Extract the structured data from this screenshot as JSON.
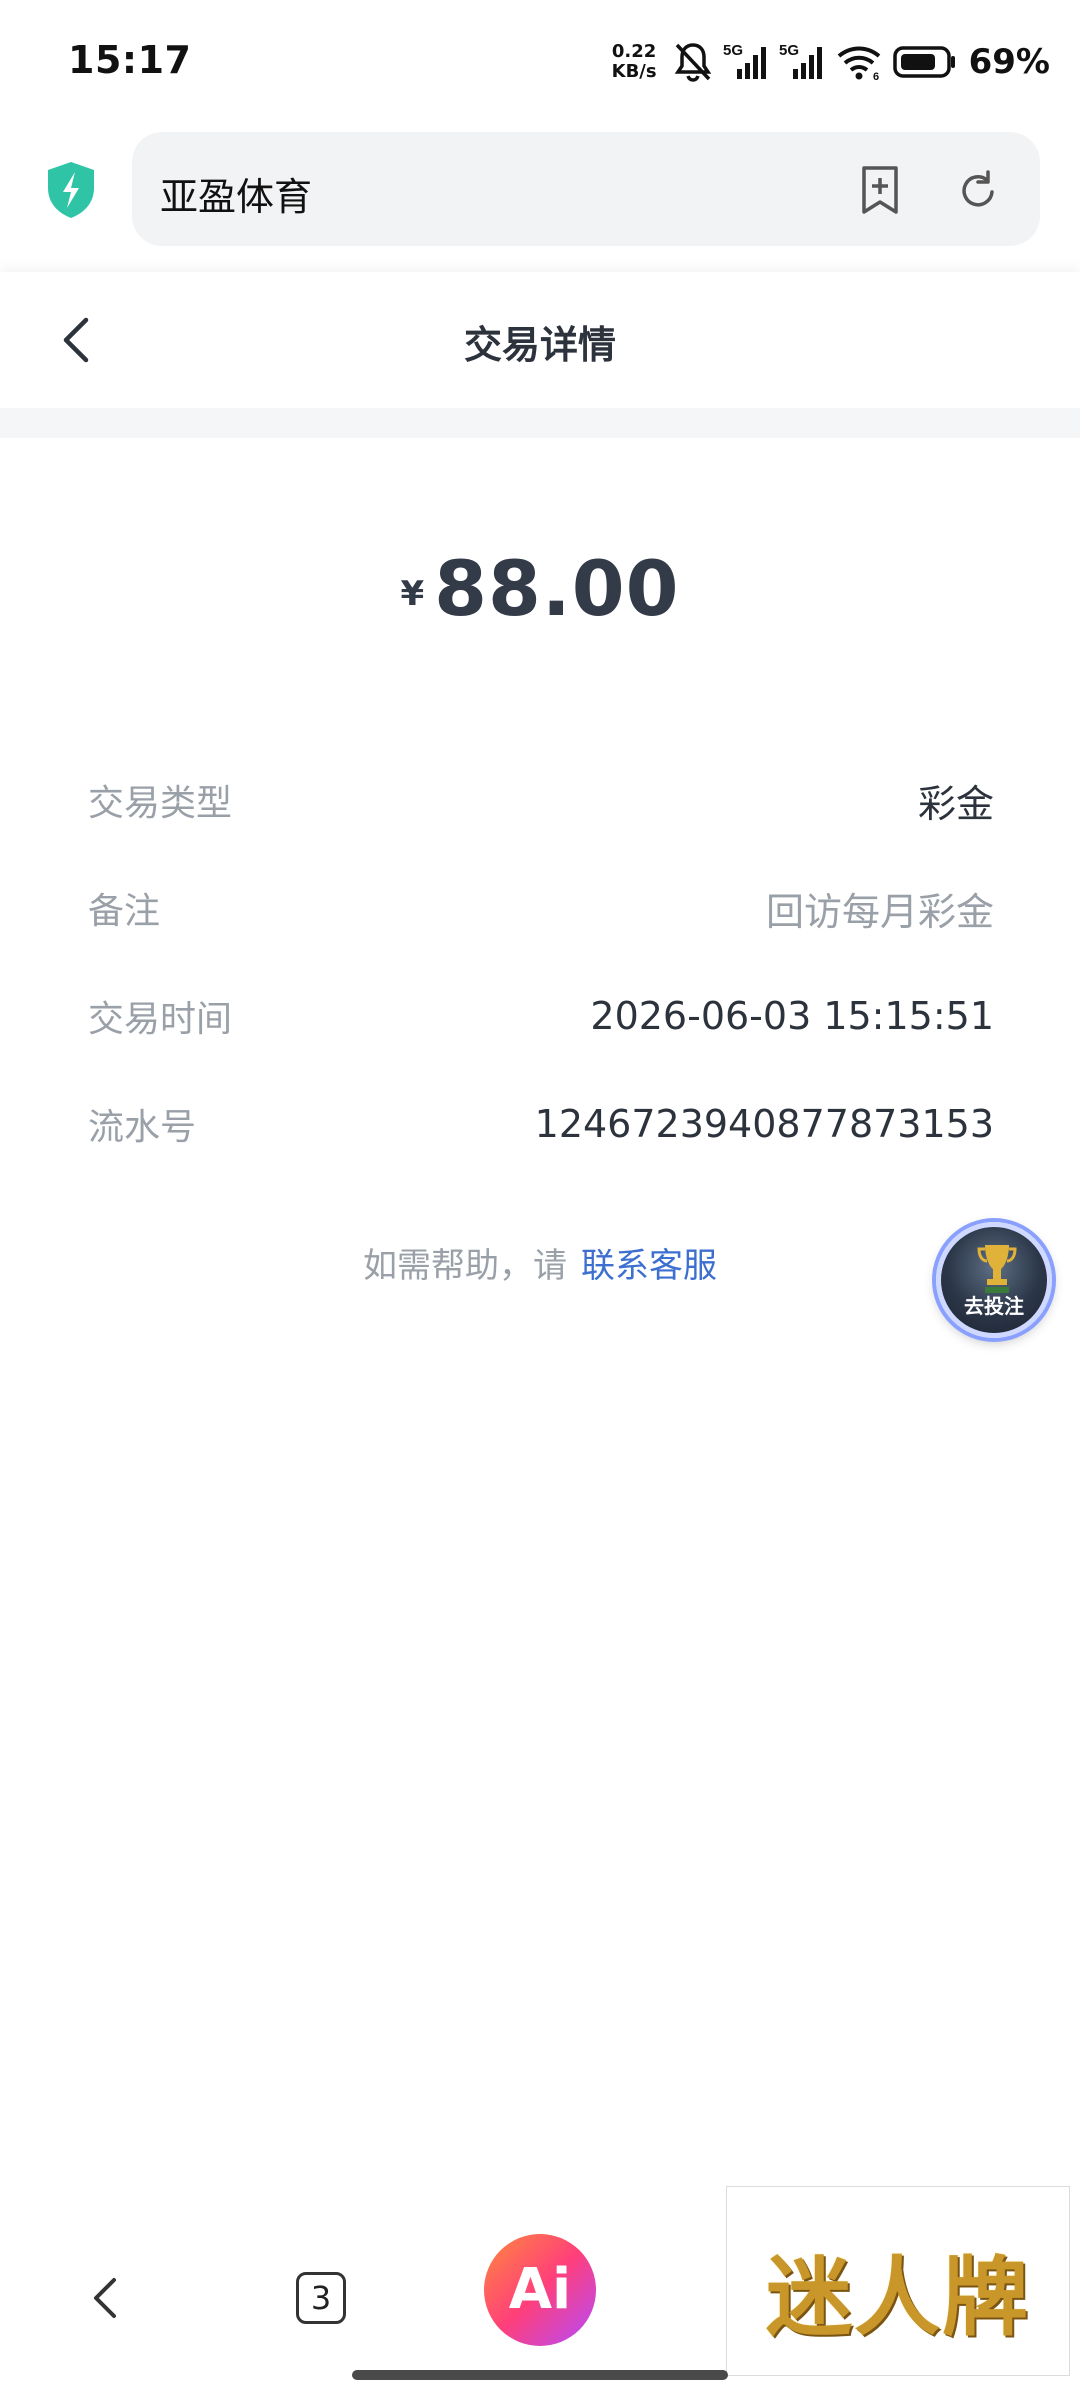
{
  "status_bar": {
    "time": "15:17",
    "net_speed_value": "0.22",
    "net_speed_unit": "KB/s",
    "battery_percent": "69%",
    "icons": [
      "mute-bell-icon",
      "signal-5g-icon",
      "signal-5g-icon",
      "wifi-icon",
      "battery-icon"
    ]
  },
  "browser": {
    "url_text": "亚盈体育",
    "icons": [
      "shield-icon",
      "bookmark-add-icon",
      "refresh-icon"
    ]
  },
  "header": {
    "title": "交易详情",
    "back_icon": "chevron-left-icon"
  },
  "transaction": {
    "currency_symbol": "¥",
    "amount": "88.00",
    "rows": [
      {
        "label": "交易类型",
        "value": "彩金"
      },
      {
        "label": "备注",
        "value": "回访每月彩金"
      },
      {
        "label": "交易时间",
        "value": "2026-06-03 15:15:51"
      },
      {
        "label": "流水号",
        "value": "1246723940877873153"
      }
    ]
  },
  "help": {
    "text": "如需帮助，请",
    "link": "联系客服"
  },
  "floating_button": {
    "label": "去投注",
    "icon": "trophy-icon"
  },
  "bottom_nav": {
    "tabs_count": "3",
    "ai_label": "Ai",
    "brand_text": "迷人牌"
  },
  "colors": {
    "link": "#3d6fd1",
    "shield": "#2ec4a5",
    "ai_gradient_start": "#ff8a3d",
    "ai_gradient_end": "#b34bff"
  }
}
